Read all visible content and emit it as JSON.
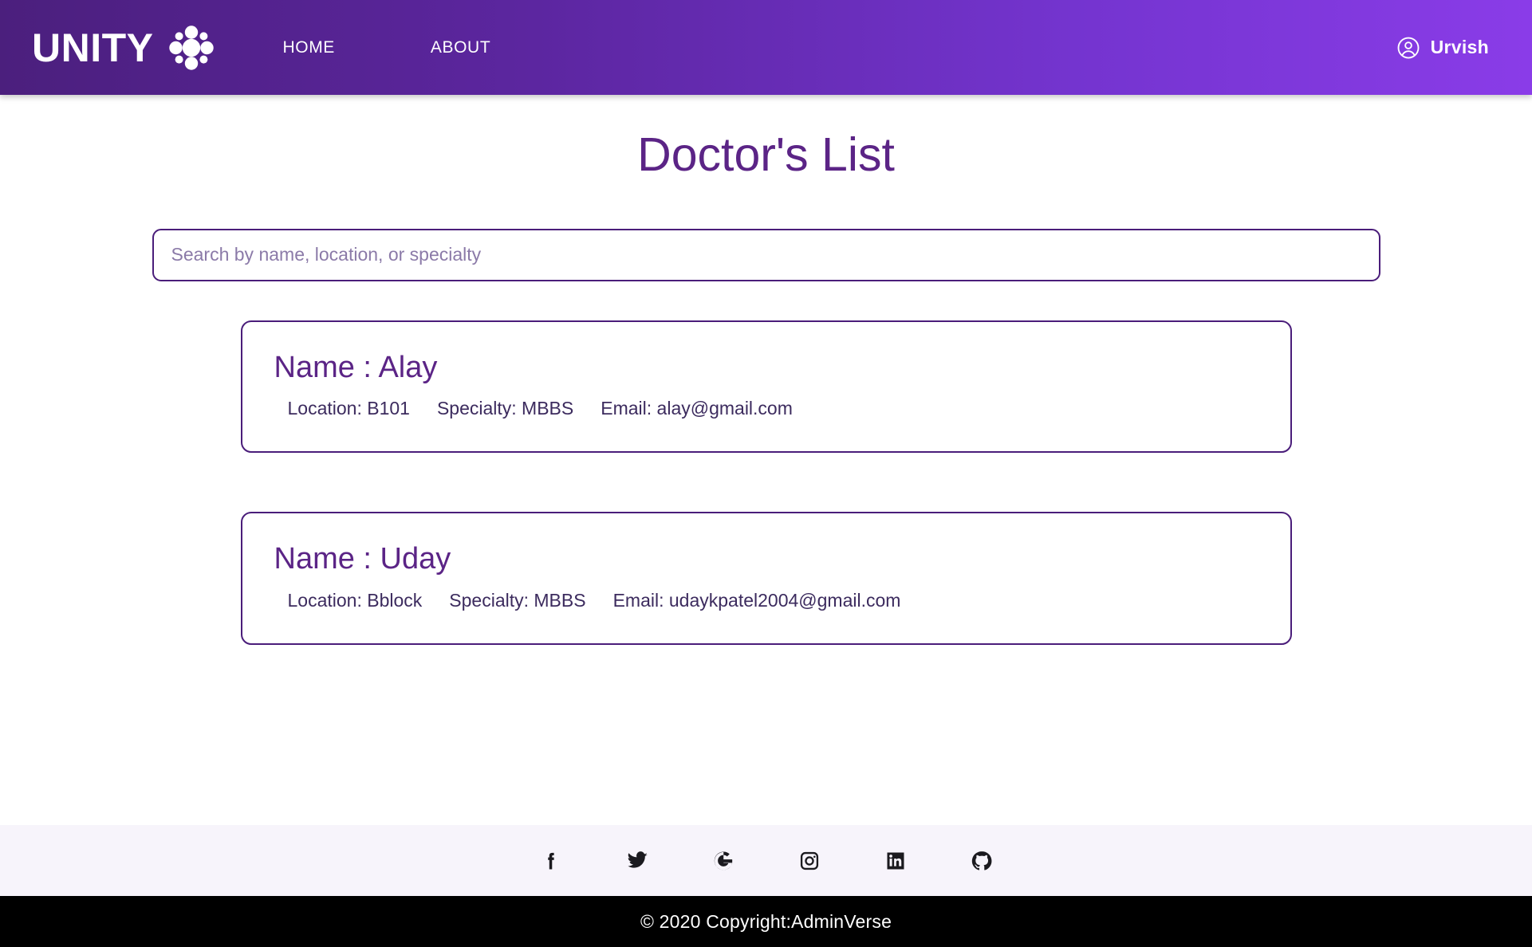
{
  "navbar": {
    "brand_word": "UNITY",
    "brand_icon": "flower-cluster-logo-icon",
    "links": [
      {
        "label": "HOME",
        "name": "nav-link-home"
      },
      {
        "label": "ABOUT",
        "name": "nav-link-about"
      }
    ],
    "user": {
      "name": "Urvish",
      "icon": "user-circle-icon"
    },
    "gradient_from": "#4b1f7d",
    "gradient_to": "#8a3ce8"
  },
  "main": {
    "title": "Doctor's List",
    "title_color": "#5b2486",
    "search": {
      "placeholder": "Search by name, location, or specialty",
      "value": "",
      "border_color": "#4a1d7a"
    },
    "doctors": [
      {
        "name": "Name : Alay",
        "location": "Location: B101",
        "specialty": "Specialty: MBBS",
        "email": "Email: alay@gmail.com"
      },
      {
        "name": "Name : Uday",
        "location": "Location: Bblock",
        "specialty": "Specialty: MBBS",
        "email": "Email: udaykpatel2004@gmail.com"
      }
    ]
  },
  "footer": {
    "background": "#f7f4fb",
    "social": [
      {
        "name": "facebook-icon",
        "label": "Facebook"
      },
      {
        "name": "twitter-icon",
        "label": "Twitter"
      },
      {
        "name": "google-icon",
        "label": "Google"
      },
      {
        "name": "instagram-icon",
        "label": "Instagram"
      },
      {
        "name": "linkedin-icon",
        "label": "LinkedIn"
      },
      {
        "name": "github-icon",
        "label": "GitHub"
      }
    ],
    "copyright": "© 2020 Copyright:AdminVerse",
    "copyright_background": "#000000"
  }
}
